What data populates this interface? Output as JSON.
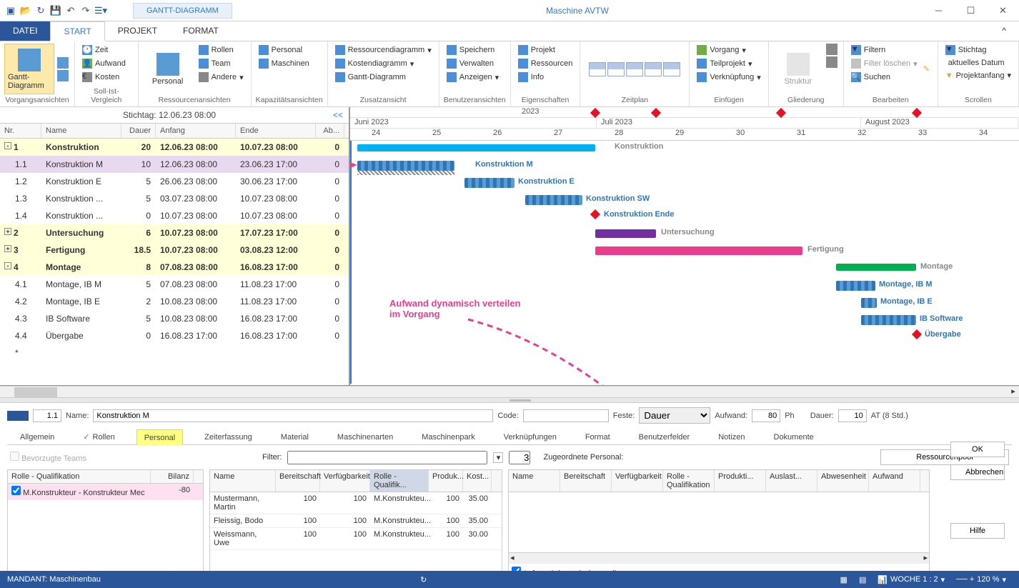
{
  "window": {
    "title": "Maschine AVTW",
    "tab_context": "GANTT-DIAGRAMM"
  },
  "menu": {
    "file": "DATEI",
    "tabs": [
      "START",
      "PROJEKT",
      "FORMAT"
    ],
    "active": "START"
  },
  "ribbon": {
    "groups": [
      {
        "label": "Vorgangsansichten",
        "big": "Gantt-Diagramm"
      },
      {
        "label": "Soll-Ist-Vergleich",
        "items": [
          "Zeit",
          "Aufwand",
          "Kosten"
        ]
      },
      {
        "label": "Ressourcenansichten",
        "big": "Personal",
        "items": [
          "Rollen",
          "Team",
          "Andere"
        ]
      },
      {
        "label": "Kapazitätsansichten",
        "items": [
          "Personal",
          "Maschinen"
        ]
      },
      {
        "label": "Zusatzansicht",
        "items": [
          "Ressourcendiagramm",
          "Kostendiagramm",
          "Gantt-Diagramm"
        ]
      },
      {
        "label": "Benutzeransichten",
        "items": [
          "Speichern",
          "Verwalten",
          "Anzeigen"
        ]
      },
      {
        "label": "Eigenschaften",
        "items": [
          "Projekt",
          "Ressourcen",
          "Info"
        ]
      },
      {
        "label": "Zeitplan",
        "zoom": [
          "0%",
          "25%",
          "50%",
          "75%",
          "100%"
        ]
      },
      {
        "label": "Einfügen",
        "items": [
          "Vorgang",
          "Teilprojekt",
          "Verknüpfung"
        ]
      },
      {
        "label": "Gliederung",
        "big": "Struktur"
      },
      {
        "label": "Bearbeiten",
        "items": [
          "Filtern",
          "Filter löschen",
          "Suchen"
        ]
      },
      {
        "label": "Scrollen",
        "items": [
          "Stichtag",
          "aktuelles Datum",
          "Projektanfang"
        ]
      }
    ]
  },
  "stichtag": {
    "label": "Stichtag: 12.06.23 08:00",
    "collapse": "<<"
  },
  "grid": {
    "headers": {
      "nr": "Nr.",
      "name": "Name",
      "dauer": "Dauer",
      "anfang": "Anfang",
      "ende": "Ende",
      "ab": "Ab..."
    },
    "rows": [
      {
        "nr": "1",
        "name": "Konstruktion",
        "dauer": "20",
        "anfang": "12.06.23 08:00",
        "ende": "10.07.23 08:00",
        "ab": "0",
        "summary": true,
        "tree": "-"
      },
      {
        "nr": "1.1",
        "name": "Konstruktion M",
        "dauer": "10",
        "anfang": "12.06.23 08:00",
        "ende": "23.06.23 17:00",
        "ab": "0",
        "selected": true
      },
      {
        "nr": "1.2",
        "name": "Konstruktion E",
        "dauer": "5",
        "anfang": "26.06.23 08:00",
        "ende": "30.06.23 17:00",
        "ab": "0"
      },
      {
        "nr": "1.3",
        "name": "Konstruktion ...",
        "dauer": "5",
        "anfang": "03.07.23 08:00",
        "ende": "10.07.23 08:00",
        "ab": "0"
      },
      {
        "nr": "1.4",
        "name": "Konstruktion ...",
        "dauer": "0",
        "anfang": "10.07.23 08:00",
        "ende": "10.07.23 08:00",
        "ab": "0"
      },
      {
        "nr": "2",
        "name": "Untersuchung",
        "dauer": "6",
        "anfang": "10.07.23 08:00",
        "ende": "17.07.23 17:00",
        "ab": "0",
        "summary": true,
        "tree": "+"
      },
      {
        "nr": "3",
        "name": "Fertigung",
        "dauer": "18.5",
        "anfang": "10.07.23 08:00",
        "ende": "03.08.23 12:00",
        "ab": "0",
        "summary": true,
        "tree": "+"
      },
      {
        "nr": "4",
        "name": "Montage",
        "dauer": "8",
        "anfang": "07.08.23 08:00",
        "ende": "16.08.23 17:00",
        "ab": "0",
        "summary": true,
        "tree": "-"
      },
      {
        "nr": "4.1",
        "name": "Montage, IB M",
        "dauer": "5",
        "anfang": "07.08.23 08:00",
        "ende": "11.08.23 17:00",
        "ab": "0"
      },
      {
        "nr": "4.2",
        "name": "Montage, IB E",
        "dauer": "2",
        "anfang": "10.08.23 08:00",
        "ende": "11.08.23 17:00",
        "ab": "0"
      },
      {
        "nr": "4.3",
        "name": "IB Software",
        "dauer": "5",
        "anfang": "10.08.23 08:00",
        "ende": "16.08.23 17:00",
        "ab": "0"
      },
      {
        "nr": "4.4",
        "name": "Übergabe",
        "dauer": "0",
        "anfang": "16.08.23 17:00",
        "ende": "16.08.23 17:00",
        "ab": "0"
      },
      {
        "nr": "*",
        "name": "",
        "dauer": "",
        "anfang": "",
        "ende": "",
        "ab": ""
      }
    ]
  },
  "timeline": {
    "year": "2023",
    "months": [
      "Juni 2023",
      "Juli 2023",
      "August 2023"
    ],
    "weeks": [
      "24",
      "25",
      "26",
      "27",
      "28",
      "29",
      "30",
      "31",
      "32",
      "33",
      "34"
    ]
  },
  "gantt_labels": {
    "konstruktion": "Konstruktion",
    "konstruktion_m": "Konstruktion M",
    "konstruktion_e": "Konstruktion E",
    "konstruktion_sw": "Konstruktion SW",
    "konstruktion_ende": "Konstruktion Ende",
    "untersuchung": "Untersuchung",
    "fertigung": "Fertigung",
    "montage": "Montage",
    "montage_ib_m": "Montage, IB M",
    "montage_ib_e": "Montage, IB E",
    "ib_software": "IB Software",
    "uebergabe": "Übergabe"
  },
  "annotation": {
    "line1": "Aufwand dynamisch verteilen",
    "line2": "im Vorgang"
  },
  "detail": {
    "nr": "1.1",
    "name_lbl": "Name:",
    "name_val": "Konstruktion M",
    "code_lbl": "Code:",
    "code_val": "",
    "feste_lbl": "Feste:",
    "feste_val": "Dauer",
    "aufwand_lbl": "Aufwand:",
    "aufwand_val": "80",
    "aufwand_unit": "Ph",
    "dauer_lbl": "Dauer:",
    "dauer_val": "10",
    "dauer_unit": "AT (8 Std.)",
    "tabs": [
      "Allgemein",
      "Rollen",
      "Personal",
      "Zeiterfassung",
      "Material",
      "Maschinenarten",
      "Maschinenpark",
      "Verknüpfungen",
      "Format",
      "Benutzerfelder",
      "Notizen",
      "Dokumente"
    ],
    "bevorzugte": "Bevorzugte Teams",
    "filter_lbl": "Filter:",
    "filter_count": "3",
    "zugeordnete_lbl": "Zugeordnete Personal:",
    "ressourcenpool_btn": "Ressourcenpool",
    "rolle_grid": {
      "h1": "Rolle - Qualifikation",
      "h2": "Bilanz",
      "row": {
        "name": "M.Konstrukteur - Konstrukteur Mec",
        "bilanz": "-80"
      }
    },
    "pers_grid": {
      "headers": [
        "Name",
        "Bereitschaft",
        "Verfügbarkeit",
        "Rolle - Qualifik...",
        "Produk...",
        "Kost..."
      ],
      "rows": [
        {
          "name": "Mustermann, Martin",
          "b": "100",
          "v": "100",
          "r": "M.Konstrukteu...",
          "p": "100",
          "k": "35.00"
        },
        {
          "name": "Fleissig, Bodo",
          "b": "100",
          "v": "100",
          "r": "M.Konstrukteu...",
          "p": "100",
          "k": "35.00"
        },
        {
          "name": "Weissmann, Uwe",
          "b": "100",
          "v": "100",
          "r": "M.Konstrukteu...",
          "p": "100",
          "k": "30.00"
        }
      ]
    },
    "assigned_grid": {
      "headers": [
        "Name",
        "Bereitschaft",
        "Verfügbarkeit",
        "Rolle - Qualifikation",
        "Produkti...",
        "Auslast...",
        "Abwesenheit",
        "Aufwand"
      ]
    },
    "checkbox": "Aufwand dynamisch verteilen",
    "buttons": {
      "ok": "OK",
      "cancel": "Abbrechen",
      "help": "Hilfe"
    }
  },
  "statusbar": {
    "mandant": "MANDANT: Maschinenbau",
    "woche": "WOCHE 1 : 2",
    "zoom": "120 %"
  },
  "chart_data": {
    "type": "gantt",
    "time_axis": {
      "start": "2023-06-12",
      "end": "2023-08-27",
      "unit": "week",
      "weeks": [
        24,
        25,
        26,
        27,
        28,
        29,
        30,
        31,
        32,
        33,
        34
      ]
    },
    "tasks": [
      {
        "id": "1",
        "name": "Konstruktion",
        "start": "2023-06-12 08:00",
        "end": "2023-07-10 08:00",
        "type": "summary",
        "color": "#00b0f0"
      },
      {
        "id": "1.1",
        "name": "Konstruktion M",
        "start": "2023-06-12 08:00",
        "end": "2023-06-23 17:00",
        "type": "task",
        "color": "#2e75b6"
      },
      {
        "id": "1.2",
        "name": "Konstruktion E",
        "start": "2023-06-26 08:00",
        "end": "2023-06-30 17:00",
        "type": "task",
        "color": "#2e75b6"
      },
      {
        "id": "1.3",
        "name": "Konstruktion SW",
        "start": "2023-07-03 08:00",
        "end": "2023-07-10 08:00",
        "type": "task",
        "color": "#2e75b6"
      },
      {
        "id": "1.4",
        "name": "Konstruktion Ende",
        "start": "2023-07-10 08:00",
        "end": "2023-07-10 08:00",
        "type": "milestone"
      },
      {
        "id": "2",
        "name": "Untersuchung",
        "start": "2023-07-10 08:00",
        "end": "2023-07-17 17:00",
        "type": "summary",
        "color": "#7030a0"
      },
      {
        "id": "3",
        "name": "Fertigung",
        "start": "2023-07-10 08:00",
        "end": "2023-08-03 12:00",
        "type": "summary",
        "color": "#e83e8c"
      },
      {
        "id": "4",
        "name": "Montage",
        "start": "2023-08-07 08:00",
        "end": "2023-08-16 17:00",
        "type": "summary",
        "color": "#00b050"
      },
      {
        "id": "4.1",
        "name": "Montage, IB M",
        "start": "2023-08-07 08:00",
        "end": "2023-08-11 17:00",
        "type": "task"
      },
      {
        "id": "4.2",
        "name": "Montage, IB E",
        "start": "2023-08-10 08:00",
        "end": "2023-08-11 17:00",
        "type": "task"
      },
      {
        "id": "4.3",
        "name": "IB Software",
        "start": "2023-08-10 08:00",
        "end": "2023-08-16 17:00",
        "type": "task"
      },
      {
        "id": "4.4",
        "name": "Übergabe",
        "start": "2023-08-16 17:00",
        "end": "2023-08-16 17:00",
        "type": "milestone"
      }
    ]
  }
}
